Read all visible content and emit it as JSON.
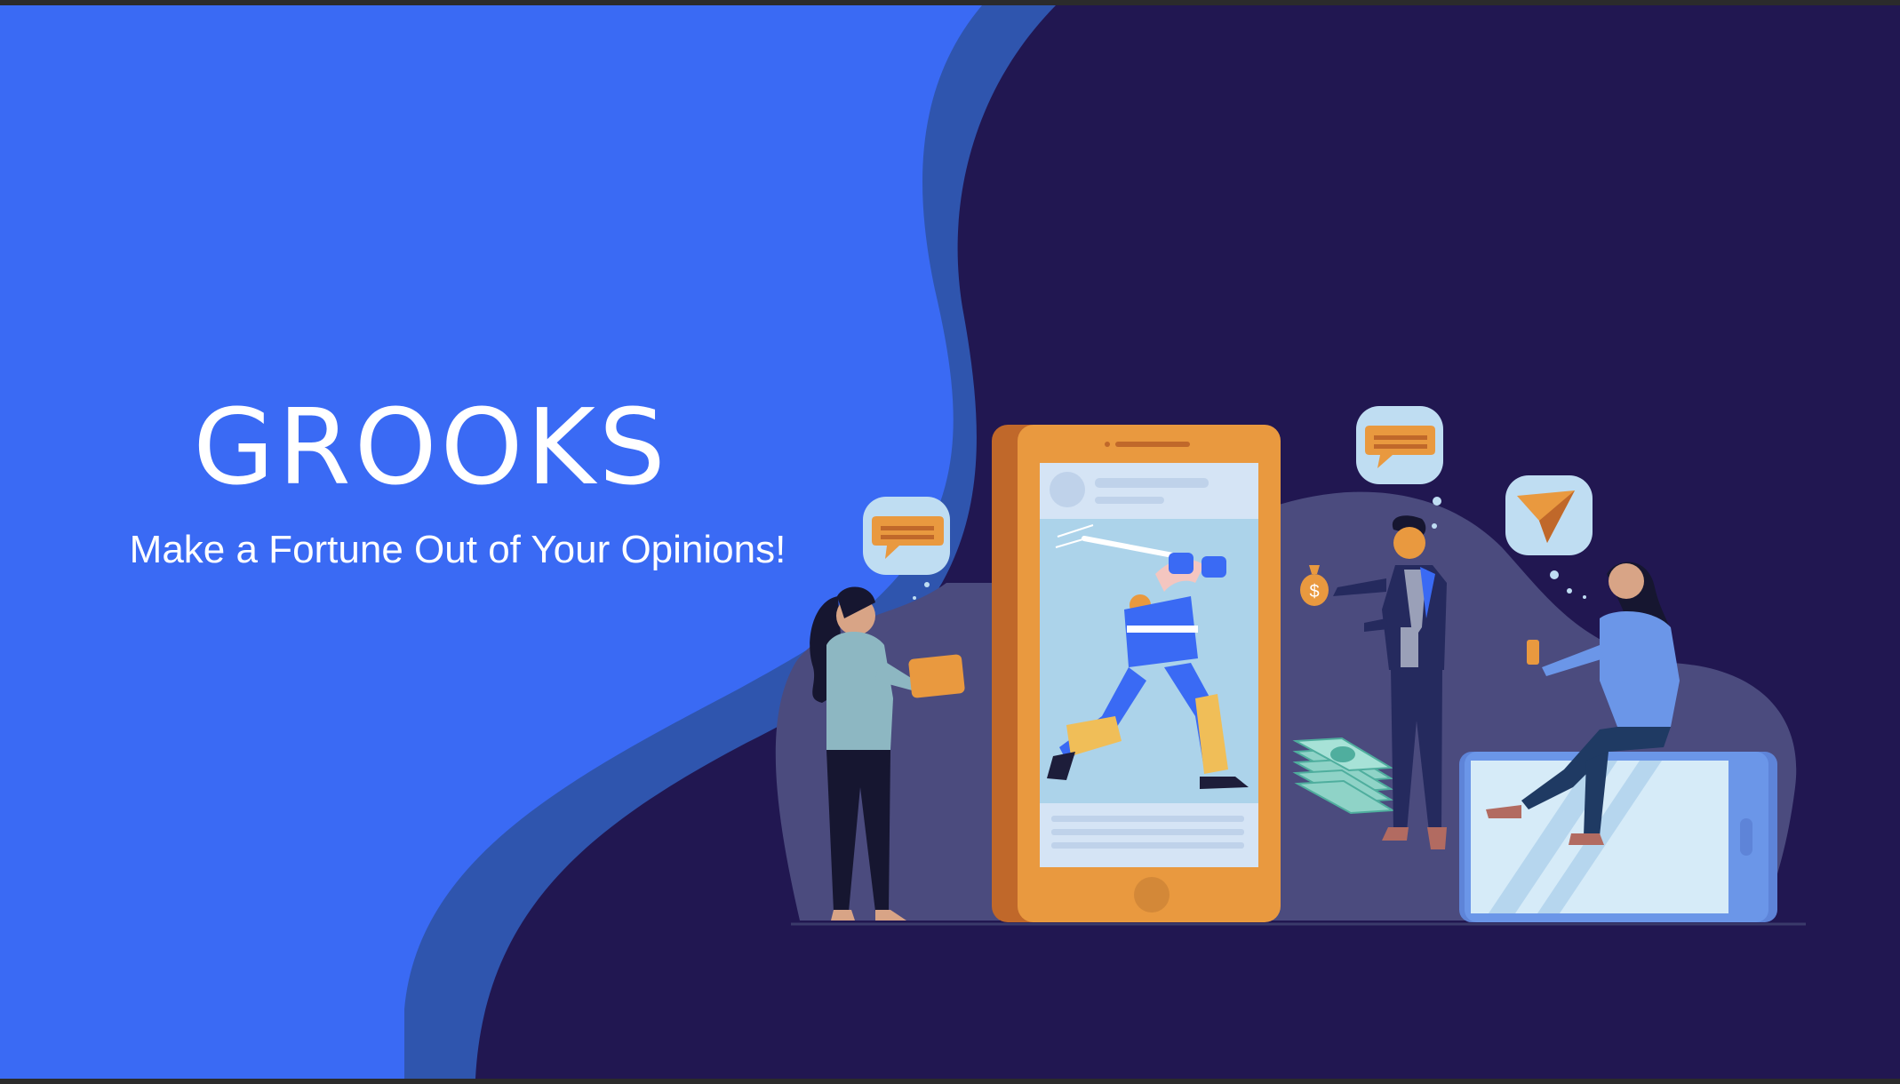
{
  "slide": {
    "title": "GROOKS",
    "tagline": "Make a Fortune Out of Your Opinions!"
  },
  "icons": {
    "chat": "chat-bubble-icon",
    "send": "send-arrow-icon",
    "money": "money-stack-icon",
    "money_bag": "money-bag-icon",
    "dollar_sign": "$"
  },
  "colors": {
    "left_panel": "#3A6AF4",
    "wave": "#2F55AE",
    "right_panel": "#211751",
    "hill": "#4B4B7E",
    "phone": "#E9993F",
    "tablet": "#6B96E8"
  }
}
